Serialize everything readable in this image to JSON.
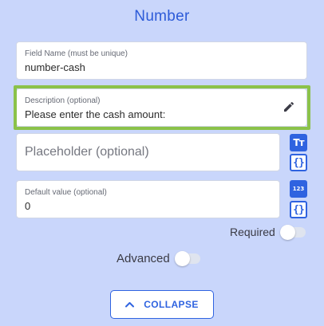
{
  "title": "Number",
  "fields": {
    "field_name": {
      "label": "Field Name (must be unique)",
      "value": "number-cash"
    },
    "description": {
      "label": "Description (optional)",
      "value": "Please enter the cash amount:"
    },
    "placeholder": {
      "placeholder": "Placeholder (optional)",
      "value": ""
    },
    "default_value": {
      "label": "Default value (optional)",
      "value": "0"
    }
  },
  "side_buttons": {
    "text_format_glyph": "Tт",
    "variable_glyph": "{}",
    "numeric_glyph": "123"
  },
  "toggles": {
    "required_label": "Required",
    "required_on": false,
    "advanced_label": "Advanced",
    "advanced_on": false
  },
  "collapse_label": "COLLAPSE",
  "colors": {
    "background": "#c9d6fb",
    "accent": "#2f63e0",
    "title": "#2d5bd8",
    "highlight": "#8bc24a"
  },
  "icons": {
    "edit": "pencil-icon",
    "text_format": "text-format-icon",
    "variable": "curly-braces-icon",
    "numeric": "numeric-icon",
    "collapse": "chevron-up-icon"
  }
}
